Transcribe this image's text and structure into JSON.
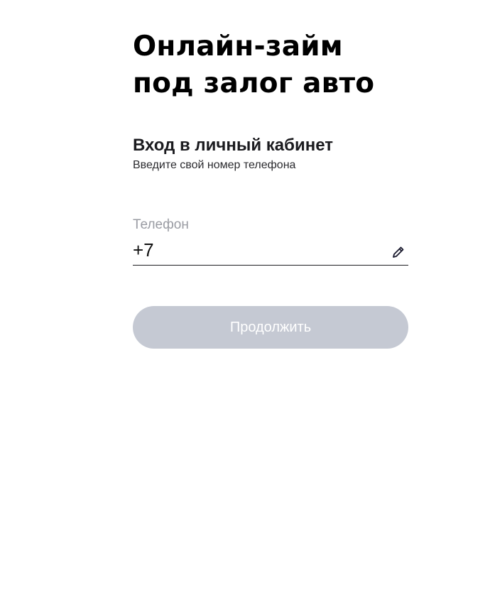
{
  "header": {
    "title_line1": "Онлайн-займ",
    "title_line2": "под залог авто"
  },
  "login": {
    "title": "Вход в личный кабинет",
    "subtitle": "Введите свой номер телефона"
  },
  "phone_field": {
    "label": "Телефон",
    "value": "+7",
    "icon": "pencil-icon"
  },
  "actions": {
    "continue_label": "Продолжить",
    "continue_disabled": true
  },
  "colors": {
    "button_disabled_bg": "#c5c9d3",
    "label_gray": "#9a9ca3",
    "text_dark": "#111111"
  }
}
